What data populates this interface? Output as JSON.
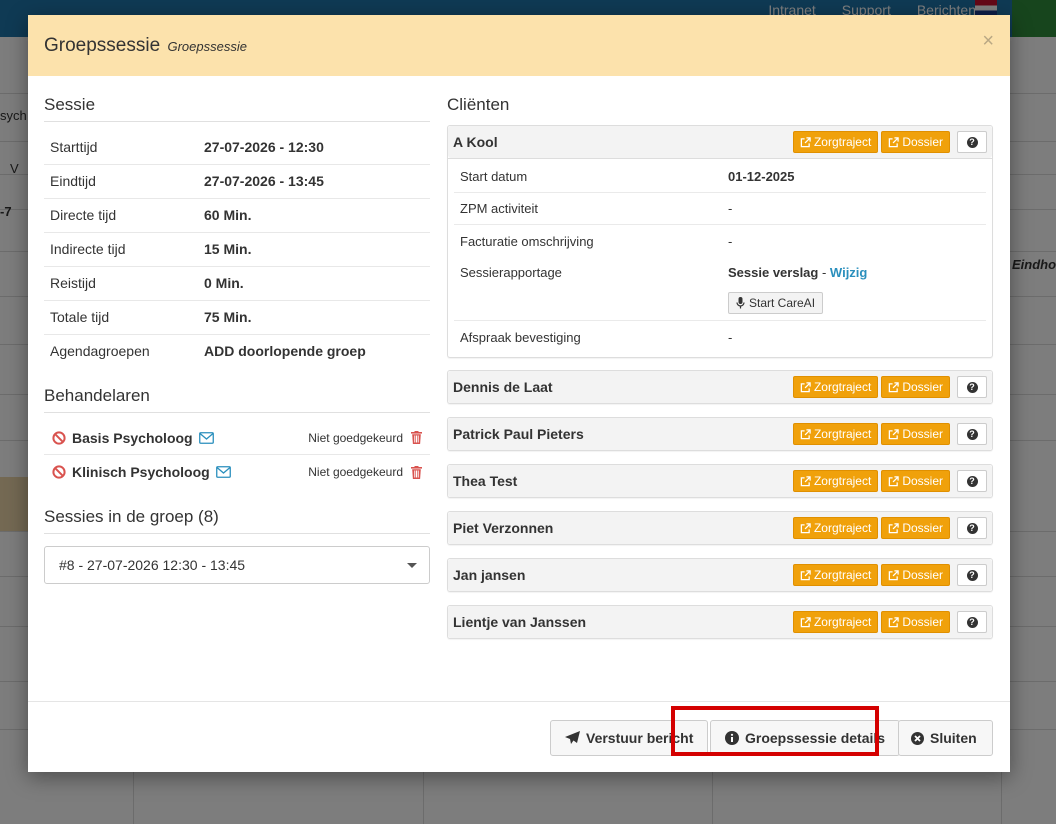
{
  "background": {
    "top_nav": [
      "Intranet",
      "Support",
      "Berichten"
    ],
    "left_fragments": [
      "sych",
      "V",
      "-7"
    ],
    "right_fragment": "Eindho"
  },
  "modal": {
    "title": "Groepssessie",
    "subtitle": "Groepssessie",
    "close_label": "×",
    "session": {
      "heading": "Sessie",
      "rows": [
        {
          "label": "Starttijd",
          "value": "27-07-2026 - 12:30"
        },
        {
          "label": "Eindtijd",
          "value": "27-07-2026 - 13:45"
        },
        {
          "label": "Directe tijd",
          "value": "60 Min."
        },
        {
          "label": "Indirecte tijd",
          "value": "15 Min."
        },
        {
          "label": "Reistijd",
          "value": "0 Min."
        },
        {
          "label": "Totale tijd",
          "value": "75 Min."
        },
        {
          "label": "Agendagroepen",
          "value": "ADD doorlopende groep"
        }
      ]
    },
    "behandelaren": {
      "heading": "Behandelaren",
      "items": [
        {
          "name": "Basis Psycholoog",
          "status": "Niet goedgekeurd"
        },
        {
          "name": "Klinisch Psycholoog",
          "status": "Niet goedgekeurd"
        }
      ]
    },
    "sessies_groep": {
      "heading": "Sessies in de groep (8)",
      "selected": "#8 - 27-07-2026 12:30 - 13:45"
    },
    "clients": {
      "heading": "Cliënten",
      "zorgtraject_label": "Zorgtraject",
      "dossier_label": "Dossier",
      "expanded": {
        "name": "A Kool",
        "rows": [
          {
            "label": "Start datum",
            "value": "01-12-2025"
          },
          {
            "label": "ZPM activiteit",
            "value": "-"
          },
          {
            "label": "Facturatie omschrijving",
            "value": "-"
          }
        ],
        "rapportage_label": "Sessierapportage",
        "rapportage_value": "Sessie verslag",
        "rapportage_sep": " - ",
        "rapportage_link": "Wijzig",
        "careai_label": "Start CareAI",
        "afspraak_label": "Afspraak bevestiging",
        "afspraak_value": "-"
      },
      "others": [
        "Dennis de Laat",
        "Patrick Paul Pieters",
        "Thea Test",
        "Piet Verzonnen",
        "Jan jansen",
        "Lientje van Janssen"
      ]
    },
    "footer": {
      "send_label": "Verstuur bericht",
      "details_label": "Groepssessie details",
      "close_label": "Sluiten"
    }
  },
  "colors": {
    "header_bg": "#fce2ac",
    "orange_button": "#f0a10b",
    "highlight": "#d40000",
    "link": "#2a8fbd",
    "danger": "#d9534f"
  }
}
